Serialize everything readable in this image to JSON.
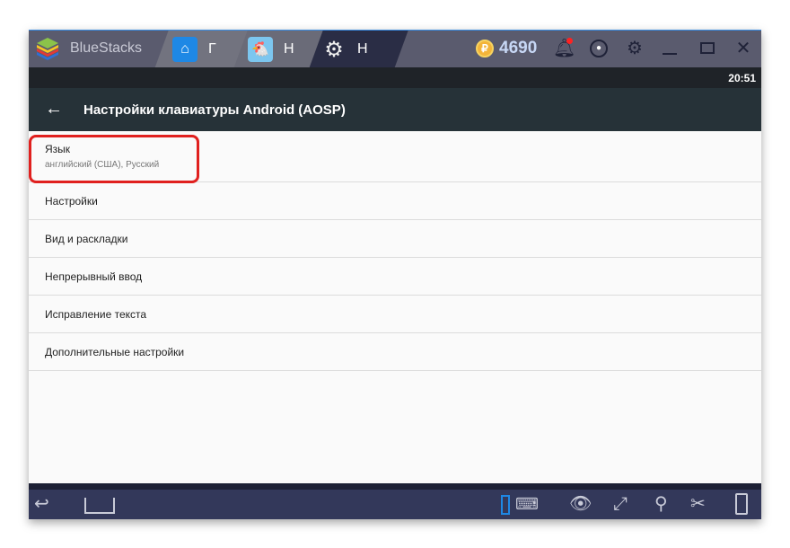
{
  "titlebar": {
    "brand": "BlueStacks",
    "tabs": [
      {
        "label": "Г",
        "icon": "home-icon"
      },
      {
        "label": "Н",
        "icon": "chicken-game-icon"
      },
      {
        "label": "Н",
        "icon": "settings-gear-icon"
      }
    ],
    "coins": "4690",
    "coin_symbol": "₽"
  },
  "status": {
    "time": "20:51"
  },
  "appbar": {
    "title": "Настройки клавиатуры Android (AOSP)"
  },
  "list": [
    {
      "title": "Язык",
      "subtitle": "английский (США), Русский"
    },
    {
      "title": "Настройки"
    },
    {
      "title": "Вид и раскладки"
    },
    {
      "title": "Непрерывный ввод"
    },
    {
      "title": "Исправление текста"
    },
    {
      "title": "Дополнительные настройки"
    }
  ],
  "colors": {
    "highlight": "#e0201e",
    "appbar": "#263238",
    "titlebar": "#5a5b6e",
    "navbar": "#33385a"
  }
}
